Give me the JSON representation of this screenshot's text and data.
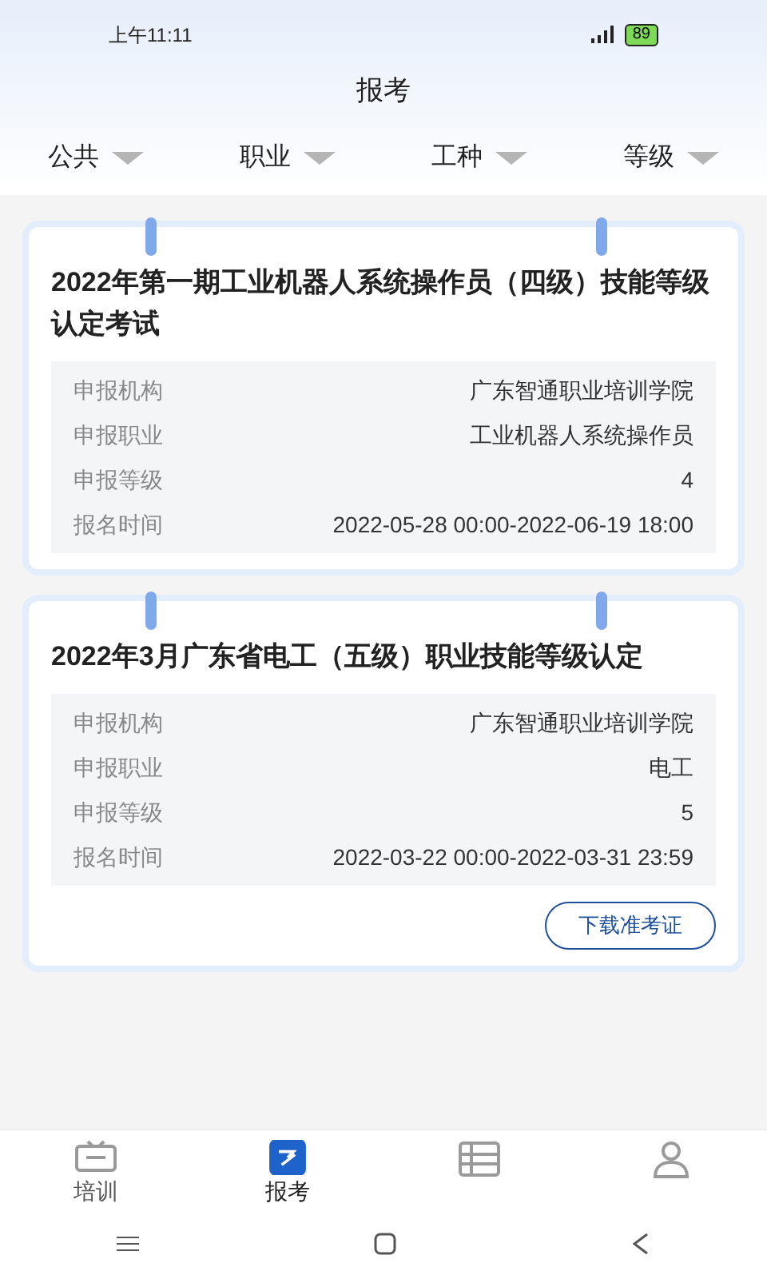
{
  "status_bar": {
    "time": "上午11:11",
    "battery": "89"
  },
  "header": {
    "title": "报考"
  },
  "filters": [
    {
      "label": "公共"
    },
    {
      "label": "职业"
    },
    {
      "label": "工种"
    },
    {
      "label": "等级"
    }
  ],
  "exams": [
    {
      "title": "2022年第一期工业机器人系统操作员（四级）技能等级认定考试",
      "fields": [
        {
          "label": "申报机构",
          "value": "广东智通职业培训学院"
        },
        {
          "label": "申报职业",
          "value": "工业机器人系统操作员"
        },
        {
          "label": "申报等级",
          "value": "4"
        },
        {
          "label": "报名时间",
          "value": "2022-05-28 00:00-2022-06-19 18:00"
        }
      ]
    },
    {
      "title": "2022年3月广东省电工（五级）职业技能等级认定",
      "fields": [
        {
          "label": "申报机构",
          "value": "广东智通职业培训学院"
        },
        {
          "label": "申报职业",
          "value": "电工"
        },
        {
          "label": "申报等级",
          "value": "5"
        },
        {
          "label": "报名时间",
          "value": "2022-03-22 00:00-2022-03-31 23:59"
        }
      ],
      "button": "下载准考证"
    }
  ],
  "tabs": [
    {
      "kind": "tv",
      "label": "培训",
      "selected": false
    },
    {
      "kind": "edit",
      "label": "报考",
      "selected": true
    },
    {
      "kind": "list",
      "selected": false
    },
    {
      "kind": "user",
      "selected": false
    }
  ]
}
